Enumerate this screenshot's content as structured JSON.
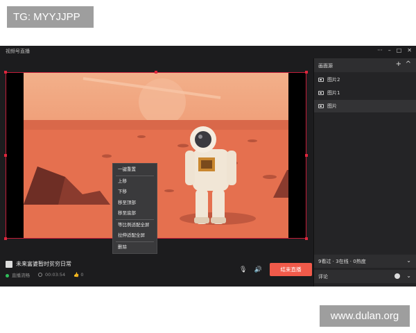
{
  "overlay": {
    "tag": "TG: MYYJJPP",
    "watermark": "www.dulan.org"
  },
  "window": {
    "title": "视频号直播",
    "controls": {
      "more": "···",
      "minimize": "–",
      "maximize": "□",
      "close": "✕"
    }
  },
  "context_menu": {
    "items": [
      "一键重置",
      "上移",
      "下移",
      "移至顶部",
      "移至底部",
      "等比例适配全屏",
      "拉伸适配全屏",
      "删除"
    ]
  },
  "stream": {
    "title": "未来富婆暂时贫穷日常",
    "status": "直播流畅",
    "duration": "00:03:54",
    "likes": "0",
    "end_button": "结束直播"
  },
  "sidebar": {
    "sources_header": "画面源",
    "add_icon": "+",
    "collapse_icon": "^",
    "sources": [
      {
        "label": "图片2",
        "active": false
      },
      {
        "label": "图片1",
        "active": false
      },
      {
        "label": "图片",
        "active": true
      }
    ],
    "viewers": "9看过 · 3在线 · 0热度",
    "comments": "评论"
  },
  "colors": {
    "accent": "#f15a4a",
    "selection": "#c41e3a",
    "live": "#2fbf5a"
  }
}
